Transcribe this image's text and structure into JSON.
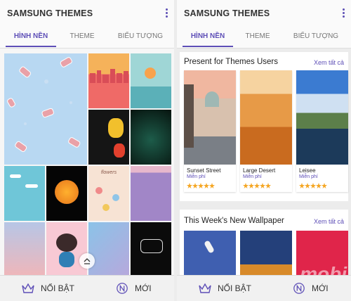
{
  "left": {
    "app_title": "SAMSUNG THEMES",
    "tabs": [
      {
        "label": "HÌNH NỀN",
        "active": true
      },
      {
        "label": "THEME",
        "active": false
      },
      {
        "label": "BIỂU TƯỢNG",
        "active": false
      }
    ],
    "wallpaper_label_text": "flowers",
    "bottom_nav": [
      {
        "label": "NỔI BẬT",
        "icon": "crown-icon"
      },
      {
        "label": "MỚI",
        "icon": "new-n-icon"
      }
    ]
  },
  "right": {
    "app_title": "SAMSUNG THEMES",
    "tabs": [
      {
        "label": "HÌNH NỀN",
        "active": true
      },
      {
        "label": "THEME",
        "active": false
      },
      {
        "label": "BIỂU TƯỢNG",
        "active": false
      }
    ],
    "section1": {
      "title": "Present for Themes Users",
      "see_all": "Xem tất cả",
      "cards": [
        {
          "name": "Sunset Street",
          "price": "Miễn phí",
          "rating": 5
        },
        {
          "name": "Large Desert",
          "price": "Miễn phí",
          "rating": 5
        },
        {
          "name": "Leisee",
          "price": "Miễn phí",
          "rating": 5
        }
      ]
    },
    "section2": {
      "title": "This Week's New Wallpaper",
      "see_all": "Xem tất cả"
    },
    "bottom_nav": [
      {
        "label": "NỔI BẬT",
        "icon": "crown-icon"
      },
      {
        "label": "MỚI",
        "icon": "new-n-icon"
      }
    ],
    "watermark": "mobi"
  },
  "colors": {
    "accent": "#5e4fb7",
    "star": "#f5a623"
  }
}
